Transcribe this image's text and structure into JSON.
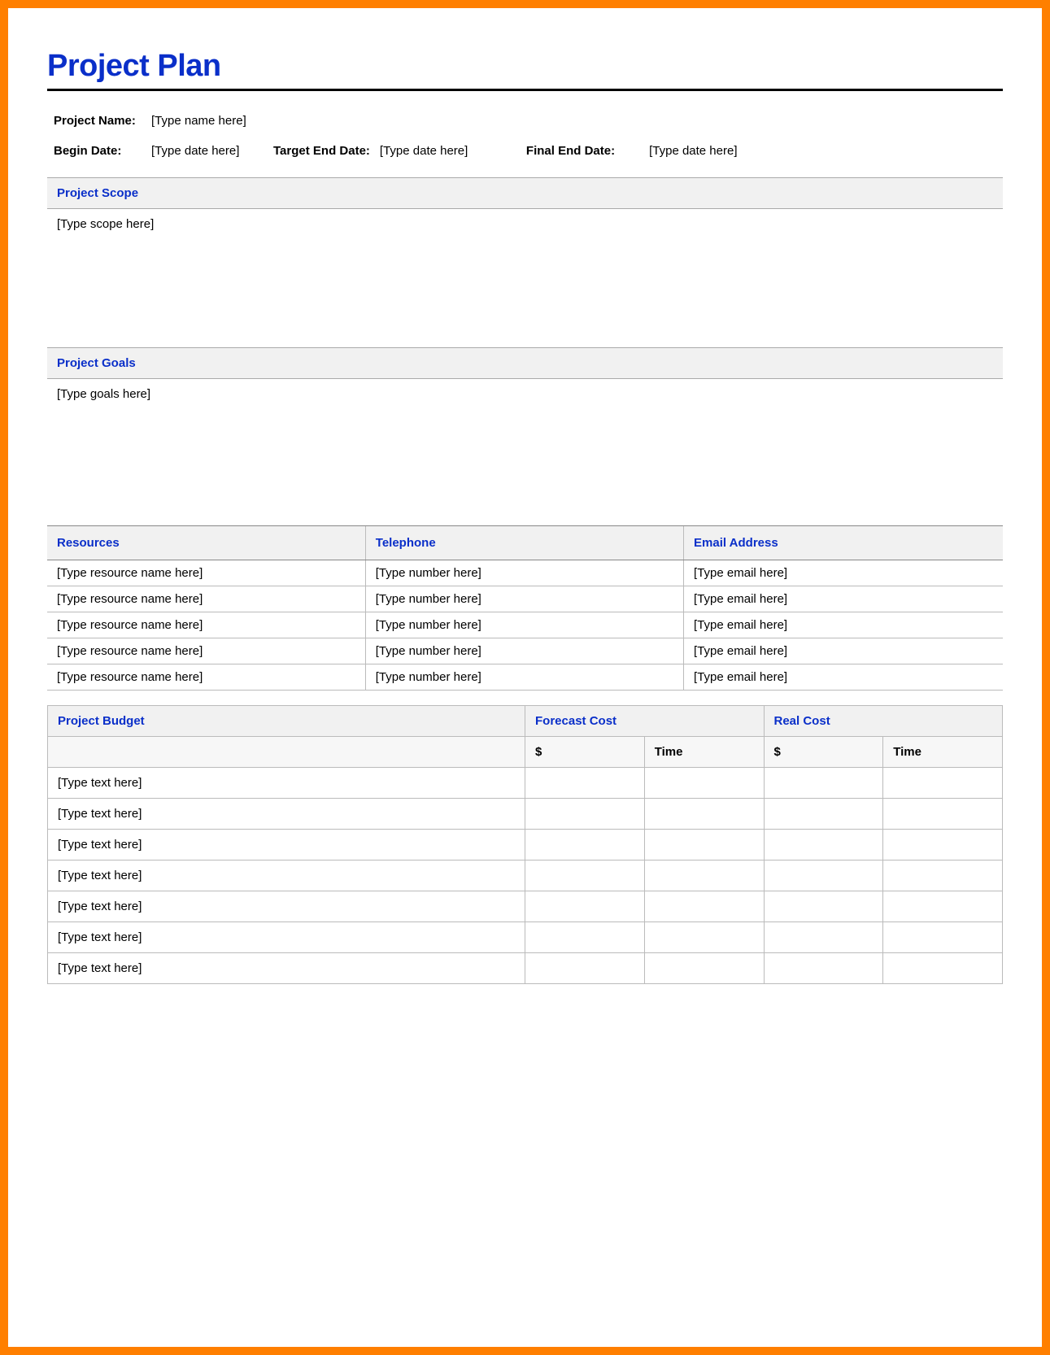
{
  "title": "Project Plan",
  "meta": {
    "project_name_label": "Project Name:",
    "project_name_placeholder": "[Type name here]",
    "begin_date_label": "Begin Date:",
    "begin_date_placeholder": "[Type date here]",
    "target_end_label": "Target End Date:",
    "target_end_placeholder": "[Type date here]",
    "final_end_label": "Final End Date:",
    "final_end_placeholder": "[Type date here]"
  },
  "scope": {
    "heading": "Project Scope",
    "placeholder": "[Type scope here]"
  },
  "goals": {
    "heading": "Project Goals",
    "placeholder": "[Type goals here]"
  },
  "resources": {
    "headers": {
      "resource": "Resources",
      "telephone": "Telephone",
      "email": "Email Address"
    },
    "rows": [
      {
        "resource": "[Type resource name here]",
        "telephone": "[Type number here]",
        "email": "[Type email here]"
      },
      {
        "resource": "[Type resource name here]",
        "telephone": "[Type number here]",
        "email": "[Type email here]"
      },
      {
        "resource": "[Type resource name here]",
        "telephone": "[Type number here]",
        "email": "[Type email here]"
      },
      {
        "resource": "[Type resource name here]",
        "telephone": "[Type number here]",
        "email": "[Type email here]"
      },
      {
        "resource": "[Type resource name here]",
        "telephone": "[Type number here]",
        "email": "[Type email here]"
      }
    ]
  },
  "budget": {
    "headers": {
      "project_budget": "Project Budget",
      "forecast": "Forecast Cost",
      "real": "Real Cost",
      "dollar": "$",
      "time": "Time"
    },
    "rows": [
      {
        "item": "[Type text here]",
        "forecast_dollar": "",
        "forecast_time": "",
        "real_dollar": "",
        "real_time": ""
      },
      {
        "item": "[Type text here]",
        "forecast_dollar": "",
        "forecast_time": "",
        "real_dollar": "",
        "real_time": ""
      },
      {
        "item": "[Type text here]",
        "forecast_dollar": "",
        "forecast_time": "",
        "real_dollar": "",
        "real_time": ""
      },
      {
        "item": "[Type text here]",
        "forecast_dollar": "",
        "forecast_time": "",
        "real_dollar": "",
        "real_time": ""
      },
      {
        "item": "[Type text here]",
        "forecast_dollar": "",
        "forecast_time": "",
        "real_dollar": "",
        "real_time": ""
      },
      {
        "item": "[Type text here]",
        "forecast_dollar": "",
        "forecast_time": "",
        "real_dollar": "",
        "real_time": ""
      },
      {
        "item": "[Type text here]",
        "forecast_dollar": "",
        "forecast_time": "",
        "real_dollar": "",
        "real_time": ""
      }
    ]
  }
}
